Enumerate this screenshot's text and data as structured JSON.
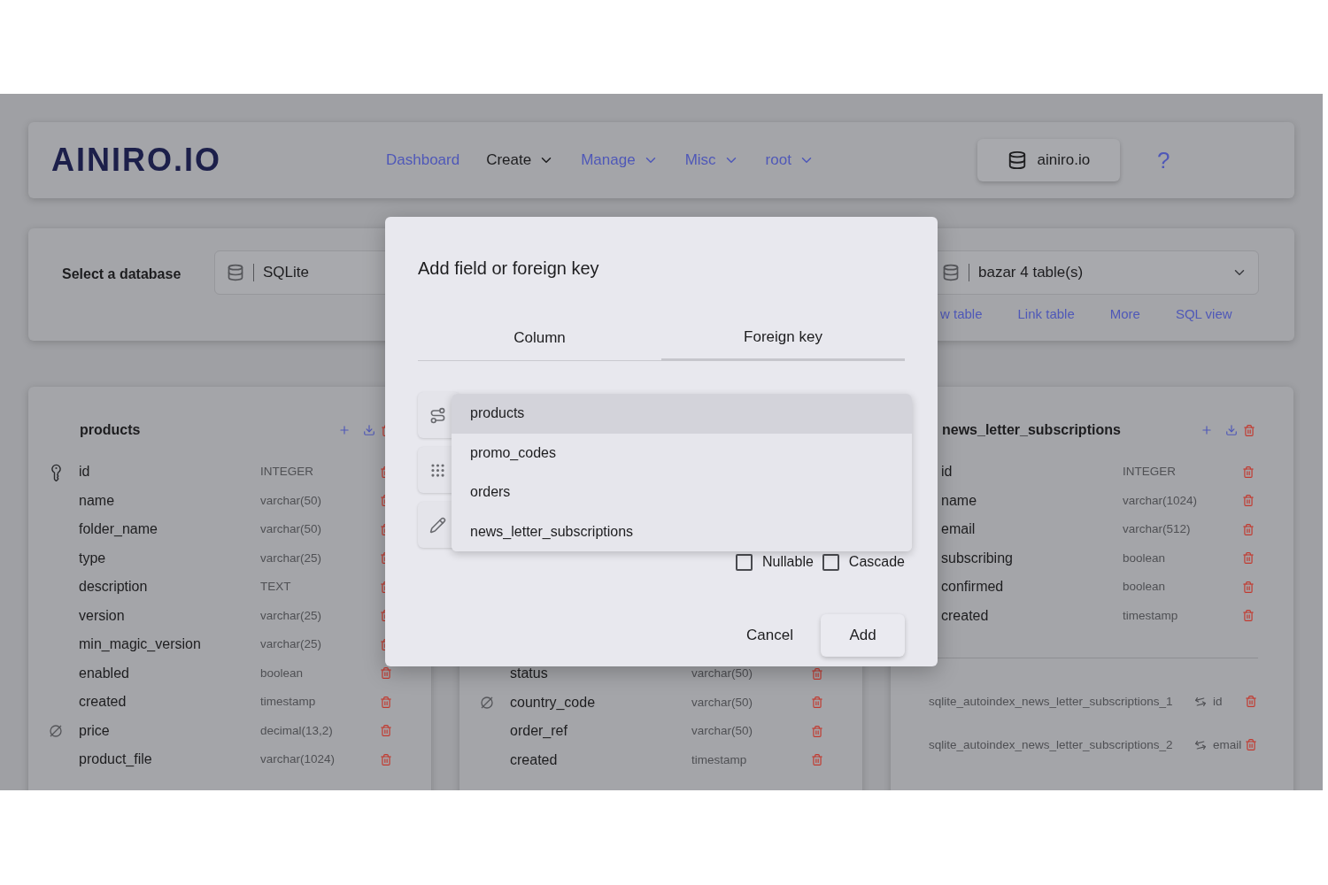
{
  "nav": {
    "logo": "AINIRO.IO",
    "links": [
      {
        "label": "Dashboard",
        "dropdown": false,
        "selected": false
      },
      {
        "label": "Create",
        "dropdown": true,
        "selected": true
      },
      {
        "label": "Manage",
        "dropdown": true,
        "selected": false
      },
      {
        "label": "Misc",
        "dropdown": true,
        "selected": false
      },
      {
        "label": "root",
        "dropdown": true,
        "selected": false
      }
    ],
    "database_button": "ainiro.io",
    "help": "?"
  },
  "database_bar": {
    "label": "Select a database",
    "database_select": "SQLite",
    "table_select": "bazar 4 table(s)",
    "actions": [
      "w table",
      "Link table",
      "More",
      "SQL view"
    ]
  },
  "tables": [
    {
      "name": "products",
      "columns": [
        {
          "name": "id",
          "type": "INTEGER",
          "kind": "primary_key"
        },
        {
          "name": "name",
          "type": "varchar(50)",
          "kind": "plain"
        },
        {
          "name": "folder_name",
          "type": "varchar(50)",
          "kind": "plain"
        },
        {
          "name": "type",
          "type": "varchar(25)",
          "kind": "plain"
        },
        {
          "name": "description",
          "type": "TEXT",
          "kind": "plain"
        },
        {
          "name": "version",
          "type": "varchar(25)",
          "kind": "plain"
        },
        {
          "name": "min_magic_version",
          "type": "varchar(25)",
          "kind": "plain"
        },
        {
          "name": "enabled",
          "type": "boolean",
          "kind": "plain"
        },
        {
          "name": "created",
          "type": "timestamp",
          "kind": "plain"
        },
        {
          "name": "price",
          "type": "decimal(13,2)",
          "kind": "nullable"
        },
        {
          "name": "product_file",
          "type": "varchar(1024)",
          "kind": "plain"
        }
      ]
    },
    {
      "columns": [
        {
          "name": "status",
          "type": "varchar(50)",
          "kind": "plain"
        },
        {
          "name": "country_code",
          "type": "varchar(50)",
          "kind": "nullable"
        },
        {
          "name": "order_ref",
          "type": "varchar(50)",
          "kind": "plain"
        },
        {
          "name": "created",
          "type": "timestamp",
          "kind": "plain"
        }
      ]
    },
    {
      "name": "news_letter_subscriptions",
      "columns": [
        {
          "name": "id",
          "type": "INTEGER",
          "kind": "plain"
        },
        {
          "name": "name",
          "type": "varchar(1024)",
          "kind": "plain"
        },
        {
          "name": "email",
          "type": "varchar(512)",
          "kind": "plain"
        },
        {
          "name": "subscribing",
          "type": "boolean",
          "kind": "plain"
        },
        {
          "name": "confirmed",
          "type": "boolean",
          "kind": "plain"
        },
        {
          "name": "created",
          "type": "timestamp",
          "kind": "plain"
        }
      ],
      "indexes": [
        {
          "name": "sqlite_autoindex_news_letter_subscriptions_1",
          "column": "id"
        },
        {
          "name": "sqlite_autoindex_news_letter_subscriptions_2",
          "column": "email"
        }
      ]
    }
  ],
  "dialog": {
    "title": "Add field or foreign key",
    "tabs": [
      {
        "label": "Column",
        "selected": false
      },
      {
        "label": "Foreign key",
        "selected": true
      }
    ],
    "options": [
      {
        "label": "products",
        "selected": true
      },
      {
        "label": "promo_codes",
        "selected": false
      },
      {
        "label": "orders",
        "selected": false
      },
      {
        "label": "news_letter_subscriptions",
        "selected": false
      }
    ],
    "checkboxes": [
      {
        "label": "Nullable",
        "checked": false
      },
      {
        "label": "Cascade",
        "checked": false
      }
    ],
    "buttons": [
      {
        "label": "Cancel",
        "kind": "text"
      },
      {
        "label": "Add",
        "kind": "raised"
      }
    ]
  }
}
